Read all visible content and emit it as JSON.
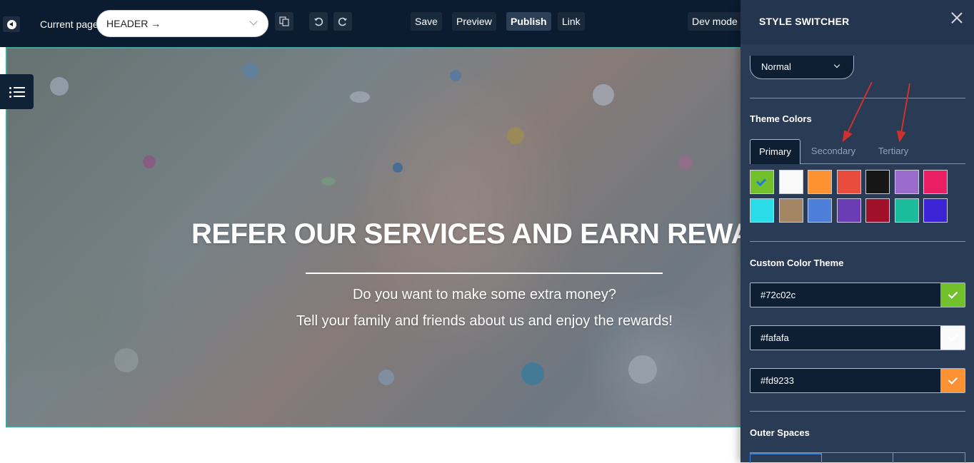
{
  "toolbar": {
    "current_page_label": "Current page",
    "page_select_value": "HEADER →",
    "save_label": "Save",
    "preview_label": "Preview",
    "publish_label": "Publish",
    "link_label": "Link",
    "dev_mode_label": "Dev mode |"
  },
  "hero": {
    "title": "REFER OUR SERVICES AND EARN REWARDS",
    "subtitle_1": "Do you want to make some extra money?",
    "subtitle_2": "Tell your family and friends about us and enjoy the rewards!"
  },
  "style_switcher": {
    "title": "STYLE SWITCHER",
    "mode_value": "Normal",
    "theme_colors_title": "Theme Colors",
    "tabs": [
      {
        "label": "Primary",
        "active": true
      },
      {
        "label": "Secondary",
        "active": false
      },
      {
        "label": "Tertiary",
        "active": false
      }
    ],
    "swatches": [
      {
        "color": "#72c02c",
        "selected": true
      },
      {
        "color": "#f9f9f9",
        "selected": false
      },
      {
        "color": "#fd9233",
        "selected": false
      },
      {
        "color": "#e74c3c",
        "selected": false
      },
      {
        "color": "#161616",
        "selected": false
      },
      {
        "color": "#9b6bcc",
        "selected": false
      },
      {
        "color": "#e91e63",
        "selected": false
      },
      {
        "color": "#2adbe8",
        "selected": false
      },
      {
        "color": "#a38463",
        "selected": false
      },
      {
        "color": "#4e7fd8",
        "selected": false
      },
      {
        "color": "#6a3db5",
        "selected": false
      },
      {
        "color": "#a0102a",
        "selected": false
      },
      {
        "color": "#1abc9c",
        "selected": false
      },
      {
        "color": "#3c24d6",
        "selected": false
      }
    ],
    "custom_theme_title": "Custom Color Theme",
    "custom_colors": [
      {
        "value": "#72c02c",
        "chip": "#72c02c"
      },
      {
        "value": "#fafafa",
        "chip": "#fafafa"
      },
      {
        "value": "#fd9233",
        "chip": "#fd9233"
      }
    ],
    "outer_spaces_title": "Outer Spaces"
  },
  "colors": {
    "toolbar_bg": "#0b1c30",
    "panel_bg": "#2a3b55",
    "hero_border": "#38a89d",
    "annotation_arrow": "#d0312d"
  }
}
